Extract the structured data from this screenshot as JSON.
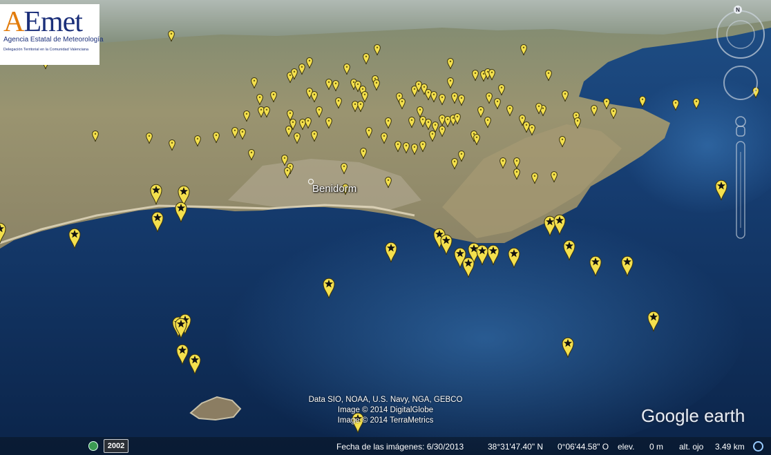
{
  "logo": {
    "mark_a": "A",
    "mark_rest": "Emet",
    "name": "Agencia Estatal de Meteorología",
    "subtitle": "Delegación Territorial en la Comunidad Valenciana"
  },
  "map": {
    "place_label": "Benidorm",
    "credits": [
      "Data SIO, NOAA, U.S. Navy, NGA, GEBCO",
      "Image © 2014 DigitalGlobe",
      "Image © 2014 TerraMetrics"
    ],
    "compass_letter": "N",
    "brand_google": "Google",
    "brand_earth": " earth",
    "colors": {
      "sea_deep": "#0b2552",
      "sea_shallow": "#3a78b5",
      "land": "#8a8560",
      "marker": "#f4e04d"
    }
  },
  "status": {
    "year": "2002",
    "imagery_date": "Fecha de las imágenes: 6/30/2013",
    "latitude": "38°31'47.40\" N",
    "longitude": "0°06'44.58\" O",
    "elev_label": "elev.",
    "elev_value": "0 m",
    "eye_label": "alt. ojo",
    "eye_value": "3.49 km"
  }
}
